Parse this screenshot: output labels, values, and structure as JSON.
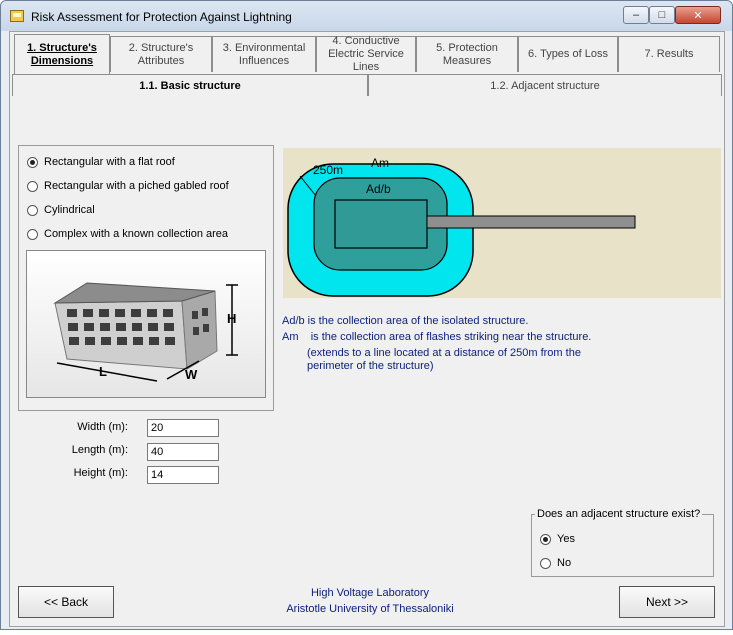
{
  "window": {
    "title": "Risk Assessment for Protection Against Lightning"
  },
  "tabs": [
    {
      "label": "1. Structure's Dimensions",
      "active": true
    },
    {
      "label": "2. Structure's Attributes"
    },
    {
      "label": "3. Environmental Influences"
    },
    {
      "label": "4. Conductive Electric Service Lines"
    },
    {
      "label": "5. Protection Measures"
    },
    {
      "label": "6. Types of Loss"
    },
    {
      "label": "7. Results"
    }
  ],
  "subtabs": [
    {
      "label": "1.1. Basic structure",
      "active": true
    },
    {
      "label": "1.2. Adjacent structure"
    }
  ],
  "shape_options": [
    {
      "label": "Rectangular with a flat roof",
      "checked": true
    },
    {
      "label": "Rectangular with a piched gabled roof"
    },
    {
      "label": "Cylindrical"
    },
    {
      "label": "Complex with a known collection area"
    }
  ],
  "building_dims": {
    "h": "H",
    "l": "L",
    "w": "W"
  },
  "fields": {
    "width": {
      "label": "Width (m):",
      "value": "20"
    },
    "length": {
      "label": "Length (m):",
      "value": "40"
    },
    "height": {
      "label": "Height (m):",
      "value": "14"
    }
  },
  "diagram": {
    "am_label": "Am",
    "adb_label": "Ad/b",
    "distance_label": "250m"
  },
  "info": {
    "line1": "Ad/b is the collection area of the isolated structure.",
    "line2": "Am    is the collection area of flashes striking near the structure.",
    "line3": "(extends to a line located at a distance of 250m from the",
    "line4": "perimeter of the structure)"
  },
  "adjacent": {
    "legend": "Does an adjacent structure exist?",
    "yes": "Yes",
    "no": "No",
    "selected": "yes"
  },
  "buttons": {
    "back": "<< Back",
    "next": "Next >>"
  },
  "footer": {
    "line1": "High Voltage Laboratory",
    "line2": "Aristotle University of Thessaloniki"
  },
  "colors": {
    "accent_text": "#0a1f7a",
    "am_zone": "#00e5ee",
    "adb_zone": "#2e9f9a"
  }
}
